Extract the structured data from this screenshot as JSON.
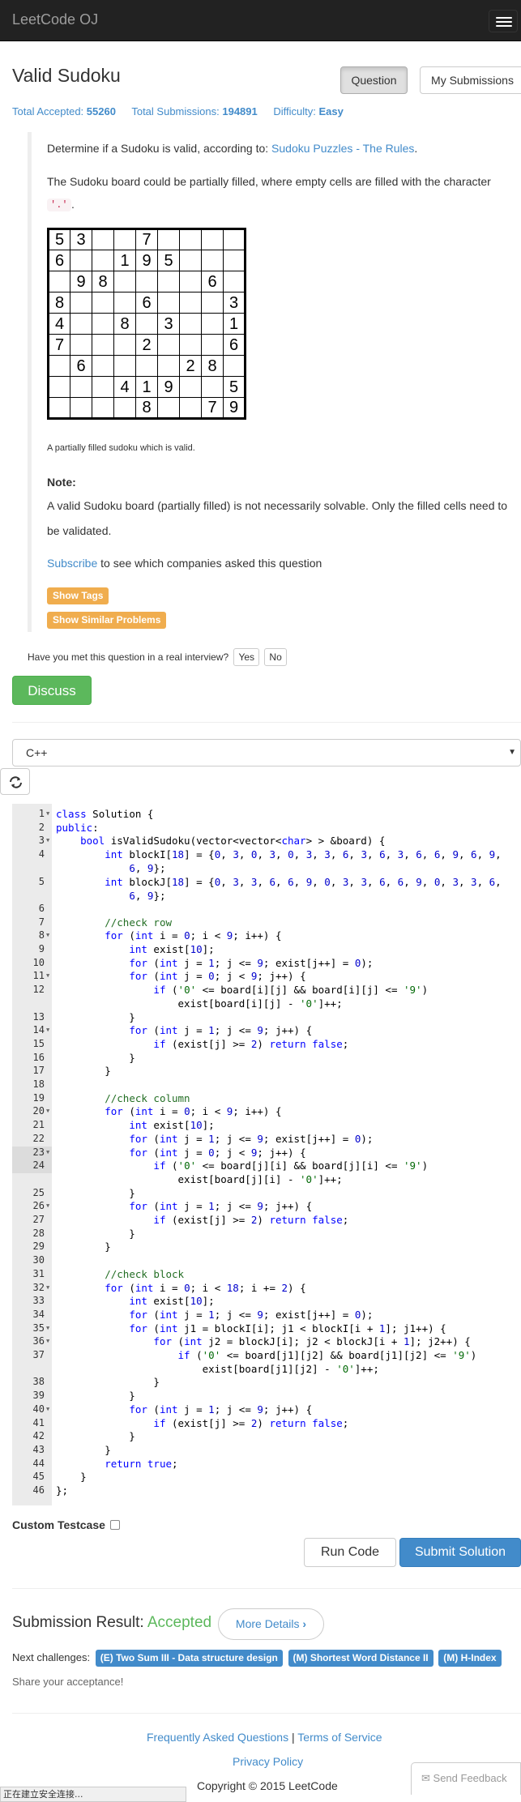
{
  "navbar": {
    "brand": "LeetCode OJ",
    "menu_icon": "hamburger-menu-icon"
  },
  "problem": {
    "title": "Valid Sudoku",
    "tabs": [
      "Question",
      "My Submissions"
    ],
    "stats": {
      "accepted_label": "Total Accepted:",
      "accepted_value": "55260",
      "submissions_label": "Total Submissions:",
      "submissions_value": "194891",
      "difficulty_label": "Difficulty:",
      "difficulty_value": "Easy"
    },
    "desc1_prefix": "Determine if a Sudoku is valid, according to: ",
    "desc1_link": "Sudoku Puzzles - The Rules",
    "desc1_suffix": ".",
    "desc2": "The Sudoku board could be partially filled, where empty cells are filled with the character",
    "desc2_code": "'.'",
    "desc2_suffix": ".",
    "sudoku": [
      [
        "5",
        "3",
        "",
        "",
        "7",
        "",
        "",
        "",
        ""
      ],
      [
        "6",
        "",
        "",
        "1",
        "9",
        "5",
        "",
        "",
        ""
      ],
      [
        "",
        "9",
        "8",
        "",
        "",
        "",
        "",
        "6",
        ""
      ],
      [
        "8",
        "",
        "",
        "",
        "6",
        "",
        "",
        "",
        "3"
      ],
      [
        "4",
        "",
        "",
        "8",
        "",
        "3",
        "",
        "",
        "1"
      ],
      [
        "7",
        "",
        "",
        "",
        "2",
        "",
        "",
        "",
        "6"
      ],
      [
        "",
        "6",
        "",
        "",
        "",
        "",
        "2",
        "8",
        ""
      ],
      [
        "",
        "",
        "",
        "4",
        "1",
        "9",
        "",
        "",
        "5"
      ],
      [
        "",
        "",
        "",
        "",
        "8",
        "",
        "",
        "7",
        "9"
      ]
    ],
    "caption": "A partially filled sudoku which is valid.",
    "note_title": "Note:",
    "note_line1": "A valid Sudoku board (partially filled) is not necessarily solvable. Only the filled cells need to",
    "note_line2": "be validated.",
    "subscribe_link": "Subscribe",
    "subscribe_text": " to see which companies asked this question",
    "show_tags": "Show Tags",
    "show_similar": "Show Similar Problems",
    "interview_q": "Have you met this question in a real interview?",
    "yes": "Yes",
    "no": "No",
    "discuss": "Discuss"
  },
  "editor": {
    "language": "C++",
    "caret_icon": "caret-down-icon",
    "refresh_icon": "refresh-icon",
    "active_line": 24
  },
  "custom_testcase": "Custom Testcase",
  "run_code": "Run Code",
  "submit_solution": "Submit Solution",
  "result": {
    "label": "Submission Result: ",
    "status": "Accepted",
    "more_details": "More Details",
    "chevron_icon": "chevron-right-icon",
    "next_label": "Next challenges:",
    "next": [
      "(E) Two Sum III - Data structure design",
      "(M) Shortest Word Distance II",
      "(M) H-Index"
    ],
    "share": "Share your acceptance!"
  },
  "footer": {
    "faq": "Frequently Asked Questions",
    "sep": " | ",
    "tos": "Terms of Service",
    "privacy": "Privacy Policy",
    "copyright": "Copyright © 2015 LeetCode",
    "feedback": "Send Feedback",
    "feedback_icon": "envelope-icon"
  },
  "status_bar": "正在建立安全连接..."
}
